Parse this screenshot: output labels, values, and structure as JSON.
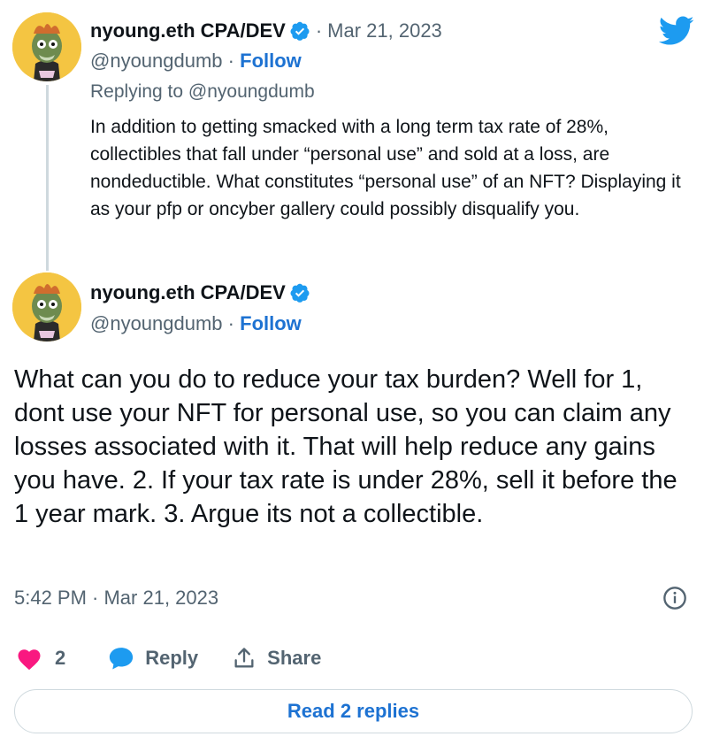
{
  "reply_tweet": {
    "author_name": "nyoung.eth CPA/DEV",
    "date": "Mar 21, 2023",
    "handle": "@nyoungdumb",
    "follow_label": "Follow",
    "replying_to": "Replying to @nyoungdumb",
    "text": "In addition to getting smacked with a long term tax rate of 28%, collectibles that fall under “personal use” and sold at a loss, are nondeductible. What constitutes “personal use” of an NFT? Displaying it as your pfp or oncyber gallery could possibly disqualify you."
  },
  "main_tweet": {
    "author_name": "nyoung.eth CPA/DEV",
    "handle": "@nyoungdumb",
    "follow_label": "Follow",
    "text": "What can you do to reduce your tax burden? Well for 1, dont use your NFT for personal use, so you can claim any losses associated with it. That will help reduce any gains you have. 2. If your tax rate is under 28%, sell it before the 1 year mark. 3. Argue its not a collectible.",
    "timestamp": "5:42 PM · Mar 21, 2023",
    "like_count": "2",
    "reply_label": "Reply",
    "share_label": "Share",
    "read_replies_label": "Read 2 replies"
  },
  "icons": {
    "verified": "verified-badge-icon",
    "twitter": "twitter-bird-icon",
    "info": "info-icon",
    "like": "heart-icon",
    "reply": "speech-bubble-icon",
    "share": "share-upload-icon"
  },
  "colors": {
    "link": "#1d72d2",
    "verified": "#1d9bf0",
    "heart": "#f91880",
    "secondary_text": "#536471"
  }
}
